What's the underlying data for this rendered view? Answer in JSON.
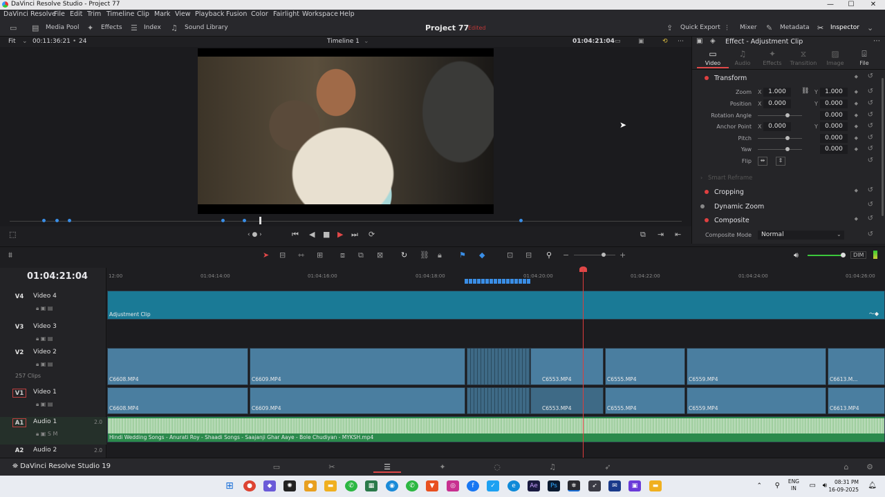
{
  "window": {
    "title": "DaVinci Resolve Studio - Project 77",
    "min": "—",
    "max": "☐",
    "close": "✕"
  },
  "menu": [
    "DaVinci Resolve",
    "File",
    "Edit",
    "Trim",
    "Timeline",
    "Clip",
    "Mark",
    "View",
    "Playback",
    "Fusion",
    "Color",
    "Fairlight",
    "Workspace",
    "Help"
  ],
  "toolbar": {
    "media_pool": "Media Pool",
    "effects": "Effects",
    "index": "Index",
    "sound_library": "Sound Library",
    "project": "Project 77",
    "status": "Edited",
    "quick_export": "Quick Export",
    "mixer": "Mixer",
    "metadata": "Metadata",
    "inspector": "Inspector"
  },
  "viewer": {
    "fit": "Fit",
    "timecode_src": "00:11:36:21",
    "fps": "24",
    "timeline_name": "Timeline 1",
    "timecode_rec": "01:04:21:04"
  },
  "inspector": {
    "title": "Effect - Adjustment Clip",
    "tabs": [
      "Video",
      "Audio",
      "Effects",
      "Transition",
      "Image",
      "File"
    ],
    "transform": "Transform",
    "zoom_label": "Zoom",
    "zoom_x": "1.000",
    "zoom_y": "1.000",
    "position_label": "Position",
    "position_x": "0.000",
    "position_y": "0.000",
    "rotation_label": "Rotation Angle",
    "rotation": "0.000",
    "anchor_label": "Anchor Point",
    "anchor_x": "0.000",
    "anchor_y": "0.000",
    "pitch_label": "Pitch",
    "pitch": "0.000",
    "yaw_label": "Yaw",
    "yaw": "0.000",
    "flip_label": "Flip",
    "smart_reframe": "Smart Reframe",
    "cropping": "Cropping",
    "dynamic_zoom": "Dynamic Zoom",
    "composite": "Composite",
    "composite_mode_label": "Composite Mode",
    "composite_mode": "Normal",
    "axis_x": "X",
    "axis_y": "Y"
  },
  "timeline": {
    "timecode": "01:04:21:04",
    "ruler": [
      "12:00",
      "01:04:14:00",
      "01:04:16:00",
      "01:04:18:00",
      "01:04:20:00",
      "01:04:22:00",
      "01:04:24:00",
      "01:04:26:00"
    ],
    "clip_count": "257 Clips",
    "dim": "DIM",
    "tracks": [
      {
        "id": "V4",
        "name": "Video 4"
      },
      {
        "id": "V3",
        "name": "Video 3"
      },
      {
        "id": "V2",
        "name": "Video 2"
      },
      {
        "id": "V1",
        "name": "Video 1"
      },
      {
        "id": "A1",
        "name": "Audio 1",
        "ch": "2.0"
      },
      {
        "id": "A2",
        "name": "Audio 2",
        "ch": "2.0"
      }
    ],
    "adjustment_clip": "Adjustment Clip",
    "clips": [
      "C6608.MP4",
      "C6609.MP4",
      "C6553.MP4",
      "C6555.MP4",
      "C6559.MP4",
      "C6613.M...",
      "C6613.MP4"
    ],
    "audio_clip": "Hindi Wedding Songs - Anurati Roy - Shaadi Songs - Saajanji Ghar Aaye - Bole Chudiyan - MYKSH.mp4"
  },
  "pagebar": {
    "app": "DaVinci Resolve Studio 19"
  },
  "taskbar": {
    "lang1": "ENG",
    "lang2": "IN",
    "time": "08:31 PM",
    "date": "16-09-2025"
  }
}
